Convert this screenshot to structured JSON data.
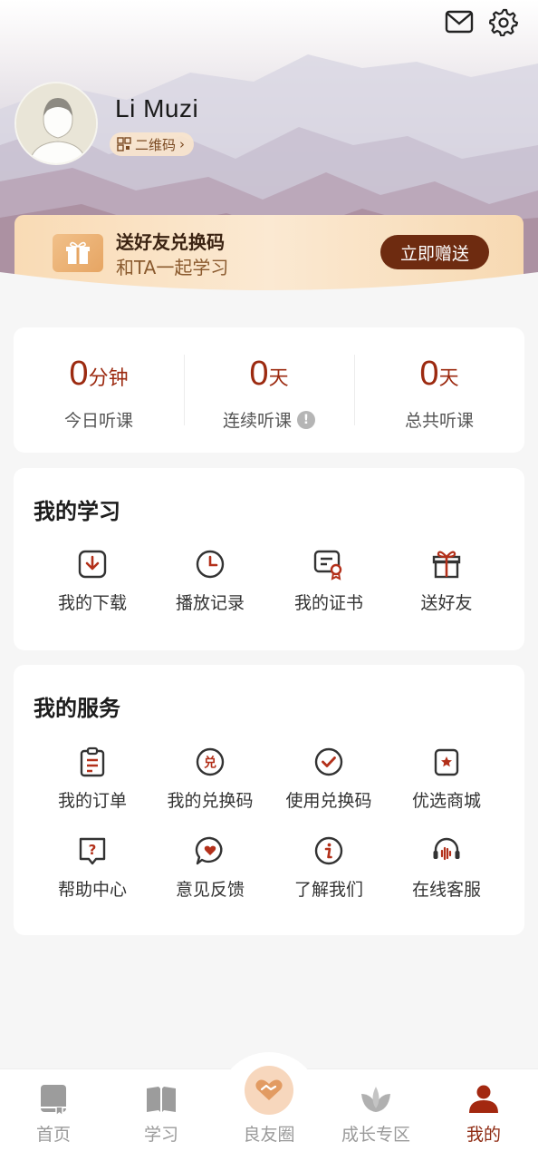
{
  "header": {
    "mail_icon": "mail-icon",
    "settings_icon": "gear-icon",
    "username": "Li Muzi",
    "qr_label": "二维码"
  },
  "gift_banner": {
    "title": "送好友兑换码",
    "subtitle": "和TA一起学习",
    "button_label": "立即赠送"
  },
  "stats": [
    {
      "value": "0",
      "unit": "分钟",
      "label": "今日听课"
    },
    {
      "value": "0",
      "unit": "天",
      "label": "连续听课"
    },
    {
      "value": "0",
      "unit": "天",
      "label": "总共听课"
    }
  ],
  "study": {
    "title": "我的学习",
    "items": [
      {
        "label": "我的下载",
        "icon": "download-icon"
      },
      {
        "label": "播放记录",
        "icon": "clock-icon"
      },
      {
        "label": "我的证书",
        "icon": "certificate-icon"
      },
      {
        "label": "送好友",
        "icon": "gift-icon"
      }
    ]
  },
  "service": {
    "title": "我的服务",
    "items": [
      {
        "label": "我的订单",
        "icon": "order-icon"
      },
      {
        "label": "我的兑换码",
        "icon": "redeem-code-icon"
      },
      {
        "label": "使用兑换码",
        "icon": "check-circle-icon"
      },
      {
        "label": "优选商城",
        "icon": "store-icon"
      },
      {
        "label": "帮助中心",
        "icon": "help-icon"
      },
      {
        "label": "意见反馈",
        "icon": "feedback-icon"
      },
      {
        "label": "了解我们",
        "icon": "info-icon"
      },
      {
        "label": "在线客服",
        "icon": "headset-icon"
      }
    ]
  },
  "bottom_nav": [
    {
      "label": "首页",
      "icon": "home-book-icon",
      "active": false
    },
    {
      "label": "学习",
      "icon": "open-book-icon",
      "active": false
    },
    {
      "label": "良友圈",
      "icon": "handshake-icon",
      "active": false
    },
    {
      "label": "成长专区",
      "icon": "leaf-icon",
      "active": false
    },
    {
      "label": "我的",
      "icon": "person-icon",
      "active": true
    }
  ],
  "colors": {
    "accent": "#9c2a10",
    "button_dark": "#6e2b10",
    "banner": "#f9dbb5"
  }
}
